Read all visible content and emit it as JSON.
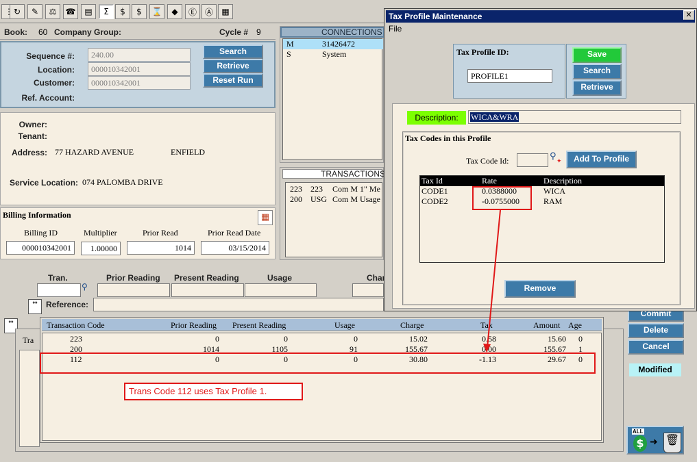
{
  "toolbar": {
    "icons": [
      "refresh-icon",
      "pencil-icon",
      "phone-icon",
      "stamp-icon",
      "sum-icon",
      "dollar-bag-icon",
      "dollar-bag-icon",
      "hourglass-icon",
      "diamond-icon",
      "e-circle-icon",
      "a-circle-icon",
      "grid-icon"
    ]
  },
  "header": {
    "book_label": "Book:",
    "book_value": "60",
    "company_group_label": "Company Group:",
    "cycle_label": "Cycle #",
    "cycle_value": "9"
  },
  "search_panel": {
    "sequence_label": "Sequence #:",
    "sequence_value": "240.00",
    "location_label": "Location:",
    "location_value": "000010342001",
    "customer_label": "Customer:",
    "customer_value": "000010342001",
    "ref_account_label": "Ref. Account:",
    "search_button": "Search",
    "retrieve_button": "Retrieve",
    "reset_button": "Reset Run"
  },
  "connections": {
    "title": "CONNECTIONS",
    "rows": [
      {
        "code": "M",
        "value": "31426472"
      },
      {
        "code": "S",
        "value": "System"
      }
    ]
  },
  "owner_panel": {
    "owner_label": "Owner:",
    "tenant_label": "Tenant:",
    "address_label": "Address:",
    "address_value": "77 HAZARD AVENUE",
    "city_value": "ENFIELD",
    "service_location_label": "Service Location:",
    "service_location_value": "074 PALOMBA DRIVE"
  },
  "transactions": {
    "title": "TRANSACTIONS",
    "rows": [
      {
        "a": "223",
        "b": "223",
        "c": "Com M 1\" Me"
      },
      {
        "a": "200",
        "b": "USG",
        "c": "Com M Usage"
      }
    ]
  },
  "billing": {
    "title": "Billing Information",
    "billing_id_label": "Billing ID",
    "billing_id_value": "000010342001",
    "multiplier_label": "Multiplier",
    "multiplier_value": "1.00000",
    "prior_read_label": "Prior Read",
    "prior_read_value": "1014",
    "prior_read_date_label": "Prior Read Date",
    "prior_read_date_value": "03/15/2014"
  },
  "entry": {
    "tran_label": "Tran.",
    "prior_reading_label": "Prior Reading",
    "present_reading_label": "Present Reading",
    "usage_label": "Usage",
    "charge_label": "Char",
    "reference_label": "Reference:"
  },
  "grid": {
    "columns": [
      "Transaction Code",
      "Prior Reading",
      "Present Reading",
      "Usage",
      "Charge",
      "Tax",
      "Amount",
      "Age"
    ],
    "rows": [
      [
        "223",
        "0",
        "0",
        "0",
        "15.02",
        "0.58",
        "15.60",
        "0"
      ],
      [
        "200",
        "1014",
        "1105",
        "91",
        "155.67",
        "0.00",
        "155.67",
        "1"
      ],
      [
        "112",
        "0",
        "0",
        "0",
        "30.80",
        "-1.13",
        "29.67",
        "0"
      ]
    ],
    "partial_header": "Tra"
  },
  "annotation": {
    "text": "Trans Code 112 uses Tax Profile 1."
  },
  "right_actions": {
    "commit": "Commit",
    "delete": "Delete",
    "cancel": "Cancel",
    "status": "Modified",
    "all_label": "ALL"
  },
  "dialog": {
    "title": "Tax Profile Maintenance",
    "menu_file": "File",
    "profile_id_label": "Tax Profile ID:",
    "profile_id_value": "PROFILE1",
    "save_button": "Save",
    "search_button": "Search",
    "retrieve_button": "Retrieve",
    "description_label": "Description:",
    "description_value": "WICA&WRA",
    "tax_codes_title": "Tax Codes in this Profile",
    "tax_code_id_label": "Tax Code Id:",
    "add_button": "Add To Profile",
    "table_columns": [
      "Tax Id",
      "Rate",
      "Description"
    ],
    "table_rows": [
      [
        "CODE1",
        "0.0388000",
        "WICA"
      ],
      [
        "CODE2",
        "-0.0755000",
        "RAM"
      ]
    ],
    "remove_button": "Remove"
  },
  "colors": {
    "save_green": "#22c93a",
    "button_blue": "#3d7aa8",
    "highlight_red": "#e01818",
    "status_cyan": "#b8f2f6",
    "description_green": "#7cff00"
  }
}
